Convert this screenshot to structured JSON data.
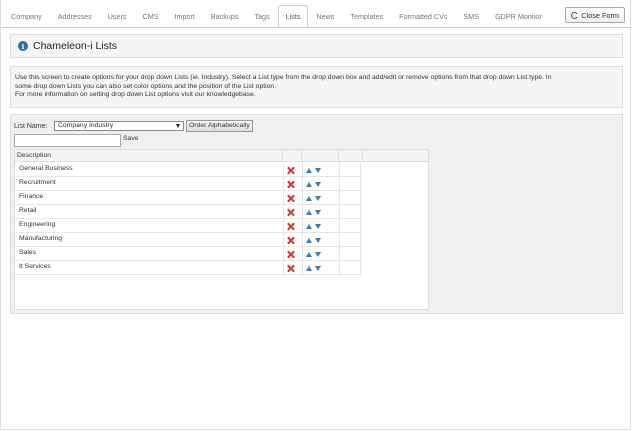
{
  "tabs": [
    {
      "label": "Company",
      "active": false
    },
    {
      "label": "Addresses",
      "active": false
    },
    {
      "label": "Users",
      "active": false
    },
    {
      "label": "CMS",
      "active": false
    },
    {
      "label": "Import",
      "active": false
    },
    {
      "label": "Backups",
      "active": false
    },
    {
      "label": "Tags",
      "active": false
    },
    {
      "label": "Lists",
      "active": true
    },
    {
      "label": "News",
      "active": false
    },
    {
      "label": "Templates",
      "active": false
    },
    {
      "label": "Formatted CVs",
      "active": false
    },
    {
      "label": "SMS",
      "active": false
    },
    {
      "label": "GDPR Monitor",
      "active": false
    }
  ],
  "close_button": {
    "label": "Close Form",
    "icon": "refresh-icon"
  },
  "header": {
    "title": "Chameleon-i Lists",
    "icon": "info-icon",
    "icon_glyph": "i"
  },
  "description": [
    "Use this screen to create options for your drop down Lists (ie. Industry). Select a List type from the drop down box and add/edit or remove options from that drop down List type. In",
    "some drop down Lists you can also set color options and the position of the List option.",
    "For more information on setting drop down List options visit our knowledgebase."
  ],
  "list_controls": {
    "label": "List Name:",
    "selected": "Company Industry",
    "order_button": "Order Alphabetically",
    "new_option_value": "",
    "save_label": "Save"
  },
  "table": {
    "columns": [
      "Description",
      "",
      "",
      ""
    ],
    "rows": [
      {
        "description": "General Business"
      },
      {
        "description": "Recruitment"
      },
      {
        "description": "Finance"
      },
      {
        "description": "Retail"
      },
      {
        "description": "Engineering"
      },
      {
        "description": "Manufacturing"
      },
      {
        "description": "Sales"
      },
      {
        "description": "It Services"
      }
    ]
  },
  "colors": {
    "accent": "#2e6da4",
    "delete": "#d9302c",
    "arrows": "#3b7bbf"
  }
}
